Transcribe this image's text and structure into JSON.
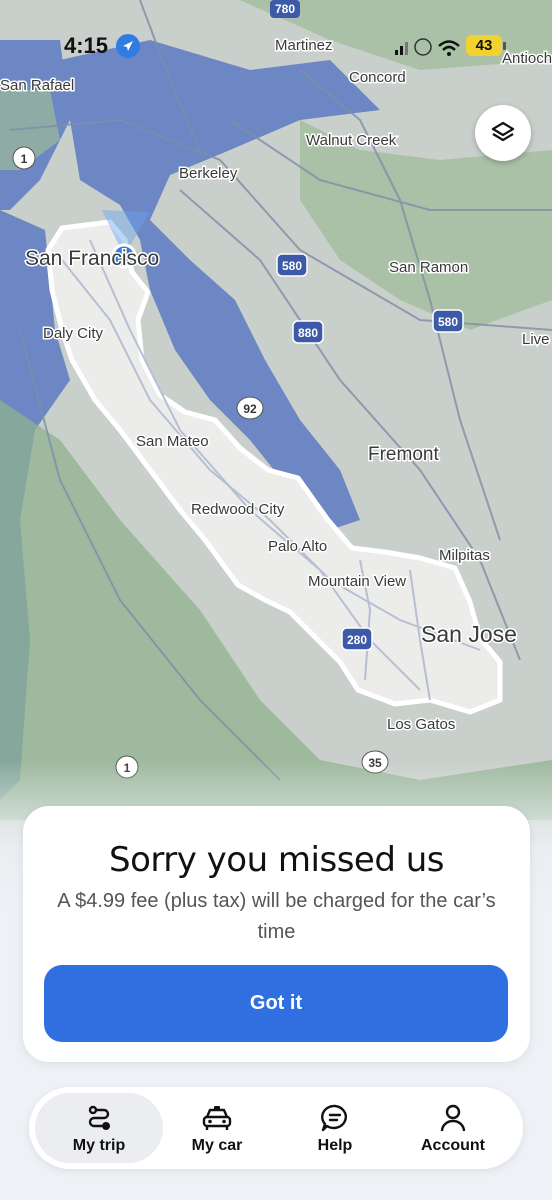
{
  "status": {
    "time": "4:15",
    "battery": "43"
  },
  "map": {
    "labels": {
      "s780": "780",
      "martinez": "Martinez",
      "antioch": "Antioch",
      "concord": "Concord",
      "sanrafael": "San Rafael",
      "walnutcreek": "Walnut Creek",
      "r1a": "1",
      "berkeley": "Berkeley",
      "sanfrancisco": "San Francisco",
      "s580a": "580",
      "sanramon": "San Ramon",
      "dalycity": "Daly City",
      "s880": "880",
      "s580b": "580",
      "livermore": "Live",
      "s92": "92",
      "sanmateo": "San Mateo",
      "fremont": "Fremont",
      "redwoodcity": "Redwood City",
      "paloalto": "Palo Alto",
      "milpitas": "Milpitas",
      "mountainview": "Mountain View",
      "sanjose": "San Jose",
      "s280": "280",
      "losgatos": "Los Gatos",
      "r1b": "1",
      "s35": "35"
    }
  },
  "dialog": {
    "title": "Sorry you missed us",
    "message": "A $4.99 fee (plus tax) will be charged for the car’s time",
    "button": "Got it"
  },
  "nav": {
    "items": [
      {
        "label": "My trip",
        "icon": "route-icon",
        "active": true
      },
      {
        "label": "My car",
        "icon": "car-icon",
        "active": false
      },
      {
        "label": "Help",
        "icon": "chat-bubble-icon",
        "active": false
      },
      {
        "label": "Account",
        "icon": "person-icon",
        "active": false
      }
    ]
  },
  "colors": {
    "accent": "#2f6fe0",
    "water": "#6d86c4",
    "land": "#c7d0c4",
    "zone": "#ececea"
  }
}
